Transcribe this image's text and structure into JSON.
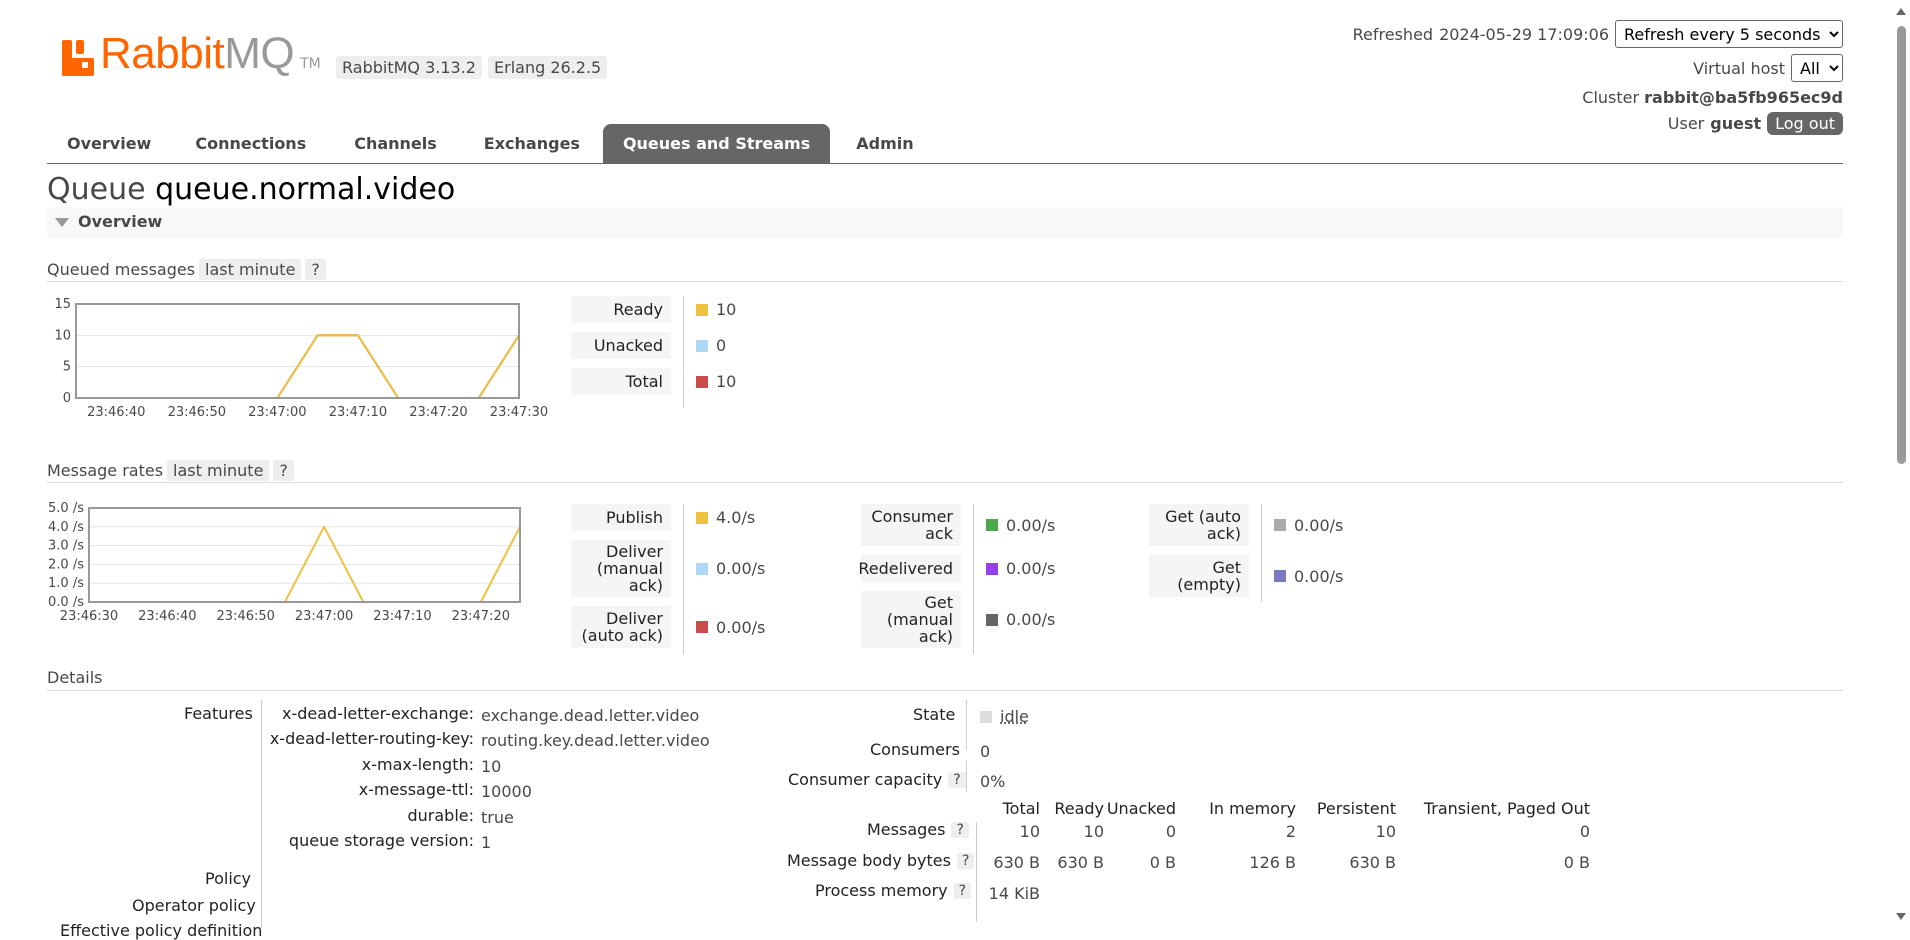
{
  "header": {
    "logo_rabbit": "Rabbit",
    "logo_mq": "MQ",
    "logo_tm": "TM",
    "rabbitmq_version": "RabbitMQ 3.13.2",
    "erlang_version": "Erlang 26.2.5",
    "refreshed_label": "Refreshed",
    "refreshed_time": "2024-05-29 17:09:06",
    "refresh_select": "Refresh every 5 seconds",
    "vhost_label": "Virtual host",
    "vhost_select": "All",
    "cluster_label": "Cluster",
    "cluster_name": "rabbit@ba5fb965ec9d",
    "user_label": "User",
    "user_name": "guest",
    "logout_label": "Log out"
  },
  "tabs": [
    {
      "label": "Overview",
      "active": false
    },
    {
      "label": "Connections",
      "active": false
    },
    {
      "label": "Channels",
      "active": false
    },
    {
      "label": "Exchanges",
      "active": false
    },
    {
      "label": "Queues and Streams",
      "active": true
    },
    {
      "label": "Admin",
      "active": false
    }
  ],
  "page": {
    "title_prefix": "Queue",
    "queue_name": "queue.normal.video",
    "section_label": "Overview"
  },
  "queued_messages": {
    "heading": "Queued messages",
    "range": "last minute",
    "help": "?",
    "legend": [
      {
        "label": "Ready",
        "value": "10",
        "color": "#edc240"
      },
      {
        "label": "Unacked",
        "value": "0",
        "color": "#afd8f8"
      },
      {
        "label": "Total",
        "value": "10",
        "color": "#cb4b4b"
      }
    ]
  },
  "message_rates": {
    "heading": "Message rates",
    "range": "last minute",
    "help": "?",
    "col1": [
      {
        "label": "Publish",
        "value": "4.0/s",
        "color": "#edc240"
      },
      {
        "label": "Deliver (manual ack)",
        "value": "0.00/s",
        "color": "#afd8f8"
      },
      {
        "label": "Deliver (auto ack)",
        "value": "0.00/s",
        "color": "#cb4b4b"
      }
    ],
    "col2": [
      {
        "label": "Consumer ack",
        "value": "0.00/s",
        "color": "#4da74d"
      },
      {
        "label": "Redelivered",
        "value": "0.00/s",
        "color": "#9440ed"
      },
      {
        "label": "Get (manual ack)",
        "value": "0.00/s",
        "color": "#666666"
      }
    ],
    "col3": [
      {
        "label": "Get (auto ack)",
        "value": "0.00/s",
        "color": "#aaaaaa"
      },
      {
        "label": "Get (empty)",
        "value": "0.00/s",
        "color": "#7c79c3"
      }
    ]
  },
  "chart_data": [
    {
      "type": "line",
      "title": "Queued messages",
      "x": [
        "23:46:35",
        "23:46:40",
        "23:46:45",
        "23:46:50",
        "23:46:55",
        "23:47:00",
        "23:47:05",
        "23:47:10",
        "23:47:15",
        "23:47:20",
        "23:47:25",
        "23:47:30"
      ],
      "xticks": [
        "23:46:40",
        "23:46:50",
        "23:47:00",
        "23:47:10",
        "23:47:20",
        "23:47:30"
      ],
      "yticks": [
        "0",
        "5",
        "10",
        "15"
      ],
      "ylim": [
        0,
        15
      ],
      "series": [
        {
          "name": "Ready",
          "color": "#edc240",
          "values": [
            0,
            0,
            0,
            0,
            0,
            0,
            10,
            10,
            0,
            0,
            0,
            10
          ]
        },
        {
          "name": "Unacked",
          "color": "#afd8f8",
          "values": [
            0,
            0,
            0,
            0,
            0,
            0,
            0,
            0,
            0,
            0,
            0,
            0
          ]
        },
        {
          "name": "Total",
          "color": "#cb4b4b",
          "values": [
            0,
            0,
            0,
            0,
            0,
            0,
            10,
            10,
            0,
            0,
            0,
            10
          ]
        }
      ]
    },
    {
      "type": "line",
      "title": "Message rates",
      "x": [
        "23:46:30",
        "23:46:35",
        "23:46:40",
        "23:46:45",
        "23:46:50",
        "23:46:55",
        "23:47:00",
        "23:47:05",
        "23:47:10",
        "23:47:15",
        "23:47:20",
        "23:47:25"
      ],
      "xticks": [
        "23:46:30",
        "23:46:40",
        "23:46:50",
        "23:47:00",
        "23:47:10",
        "23:47:20"
      ],
      "yticks": [
        "0.0 /s",
        "1.0 /s",
        "2.0 /s",
        "3.0 /s",
        "4.0 /s",
        "5.0 /s"
      ],
      "ylim": [
        0,
        5
      ],
      "series": [
        {
          "name": "Publish",
          "color": "#edc240",
          "values": [
            0,
            0,
            0,
            0,
            0,
            0,
            4,
            0,
            0,
            0,
            0,
            4
          ]
        },
        {
          "name": "Deliver (manual ack)",
          "color": "#afd8f8",
          "values": [
            0,
            0,
            0,
            0,
            0,
            0,
            0,
            0,
            0,
            0,
            0,
            0
          ]
        },
        {
          "name": "Get (empty)",
          "color": "#7c79c3",
          "values": [
            0,
            0,
            0,
            0,
            0,
            0,
            0,
            0,
            0,
            0,
            0,
            0
          ]
        }
      ]
    }
  ],
  "details": {
    "heading": "Details",
    "features_label": "Features",
    "features": [
      {
        "key": "x-dead-letter-exchange:",
        "value": "exchange.dead.letter.video"
      },
      {
        "key": "x-dead-letter-routing-key:",
        "value": "routing.key.dead.letter.video"
      },
      {
        "key": "x-max-length:",
        "value": "10"
      },
      {
        "key": "x-message-ttl:",
        "value": "10000"
      },
      {
        "key": "durable:",
        "value": "true"
      },
      {
        "key": "queue storage version:",
        "value": "1"
      }
    ],
    "policy_label": "Policy",
    "operator_policy_label": "Operator policy",
    "effective_policy_label": "Effective policy definition",
    "state_label": "State",
    "state_value": "idle",
    "consumers_label": "Consumers",
    "consumers_value": "0",
    "consumer_capacity_label": "Consumer capacity",
    "consumer_capacity_value": "0%",
    "table_headers": [
      "Total",
      "Ready",
      "Unacked",
      "In memory",
      "Persistent",
      "Transient, Paged Out"
    ],
    "messages_label": "Messages",
    "messages_values": [
      "10",
      "10",
      "0",
      "2",
      "10",
      "0"
    ],
    "body_bytes_label": "Message body bytes",
    "body_bytes_values": [
      "630 B",
      "630 B",
      "0 B",
      "126 B",
      "630 B",
      "0 B"
    ],
    "process_memory_label": "Process memory",
    "process_memory_value": "14 KiB",
    "help": "?"
  }
}
